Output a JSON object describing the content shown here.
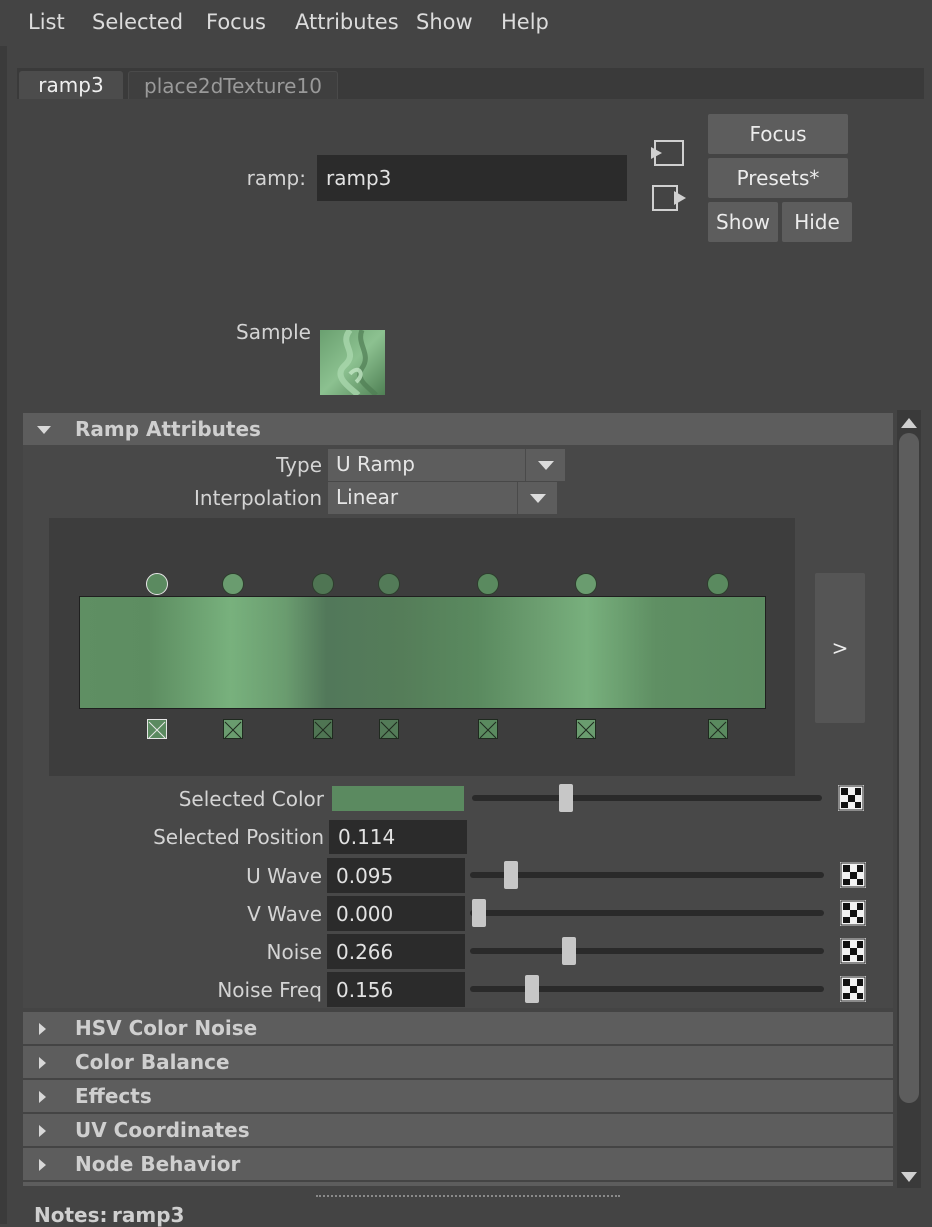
{
  "menu": [
    "List",
    "Selected",
    "Focus",
    "Attributes",
    "Show",
    "Help"
  ],
  "tabs": [
    {
      "label": "ramp3",
      "active": true
    },
    {
      "label": "place2dTexture10",
      "active": false
    }
  ],
  "node": {
    "label": "ramp:",
    "value": "ramp3",
    "buttons": {
      "focus": "Focus",
      "presets": "Presets*",
      "show": "Show",
      "hide": "Hide"
    },
    "sample_label": "Sample"
  },
  "ramp_attributes": {
    "title": "Ramp Attributes",
    "type_label": "Type",
    "type_value": "U Ramp",
    "interpolation_label": "Interpolation",
    "interpolation_value": "Linear",
    "expand_button": ">",
    "ramp_colors": [
      "#5a8a5e",
      "#7cb482",
      "#537a58",
      "#5b8360",
      "#5d8e62",
      "#79b07e",
      "#5b8a60"
    ],
    "selected_color_label": "Selected Color",
    "selected_color": "#5b8a60",
    "selected_color_slider": 0.26,
    "selected_position_label": "Selected Position",
    "selected_position": "0.114",
    "attributes": [
      {
        "label": "U Wave",
        "value": "0.095",
        "slider": 0.095
      },
      {
        "label": "V Wave",
        "value": "0.000",
        "slider": 0.0
      },
      {
        "label": "Noise",
        "value": "0.266",
        "slider": 0.266
      },
      {
        "label": "Noise Freq",
        "value": "0.156",
        "slider": 0.156
      }
    ]
  },
  "sections": [
    "HSV Color Noise",
    "Color Balance",
    "Effects",
    "UV Coordinates",
    "Node Behavior"
  ],
  "notes": {
    "label": "Notes:",
    "value": "ramp3"
  },
  "colors": {
    "background": "#444444",
    "field": "#2b2b2b",
    "button": "#5d5d5d",
    "accent_green": "#5b8a60"
  }
}
